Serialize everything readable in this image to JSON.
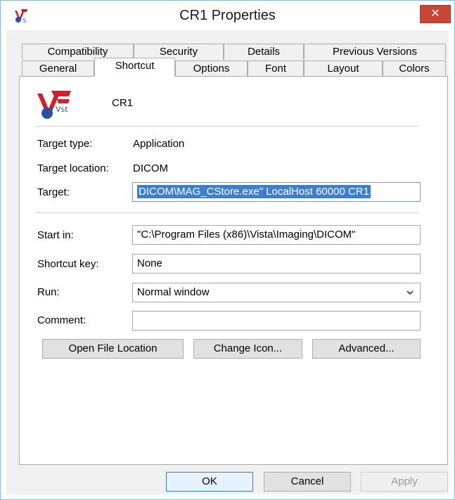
{
  "window": {
    "title": "CR1 Properties",
    "close_glyph": "✕"
  },
  "tabs": {
    "row1": [
      "Compatibility",
      "Security",
      "Details",
      "Previous Versions"
    ],
    "row2": [
      "General",
      "Shortcut",
      "Options",
      "Font",
      "Layout",
      "Colors"
    ],
    "active": "Shortcut"
  },
  "shortcut": {
    "name": "CR1",
    "target_type_label": "Target type:",
    "target_type_value": "Application",
    "target_location_label": "Target location:",
    "target_location_value": "DICOM",
    "target_label": "Target:",
    "target_value": "DICOM\\MAG_CStore.exe\" LocalHost 60000 CR1",
    "start_in_label": "Start in:",
    "start_in_value": "\"C:\\Program Files (x86)\\Vista\\Imaging\\DICOM\"",
    "shortcut_key_label": "Shortcut key:",
    "shortcut_key_value": "None",
    "run_label": "Run:",
    "run_value": "Normal window",
    "comment_label": "Comment:",
    "comment_value": "",
    "open_file_location": "Open File Location",
    "change_icon": "Change Icon...",
    "advanced": "Advanced..."
  },
  "footer": {
    "ok": "OK",
    "cancel": "Cancel",
    "apply": "Apply"
  },
  "icons": {
    "app": "vista-app-icon",
    "dropdown": "chevron-down-icon",
    "close": "close-icon"
  },
  "colors": {
    "selection": "#3a7fd0",
    "close_button": "#c94536",
    "window_border": "#8fb9dc"
  }
}
